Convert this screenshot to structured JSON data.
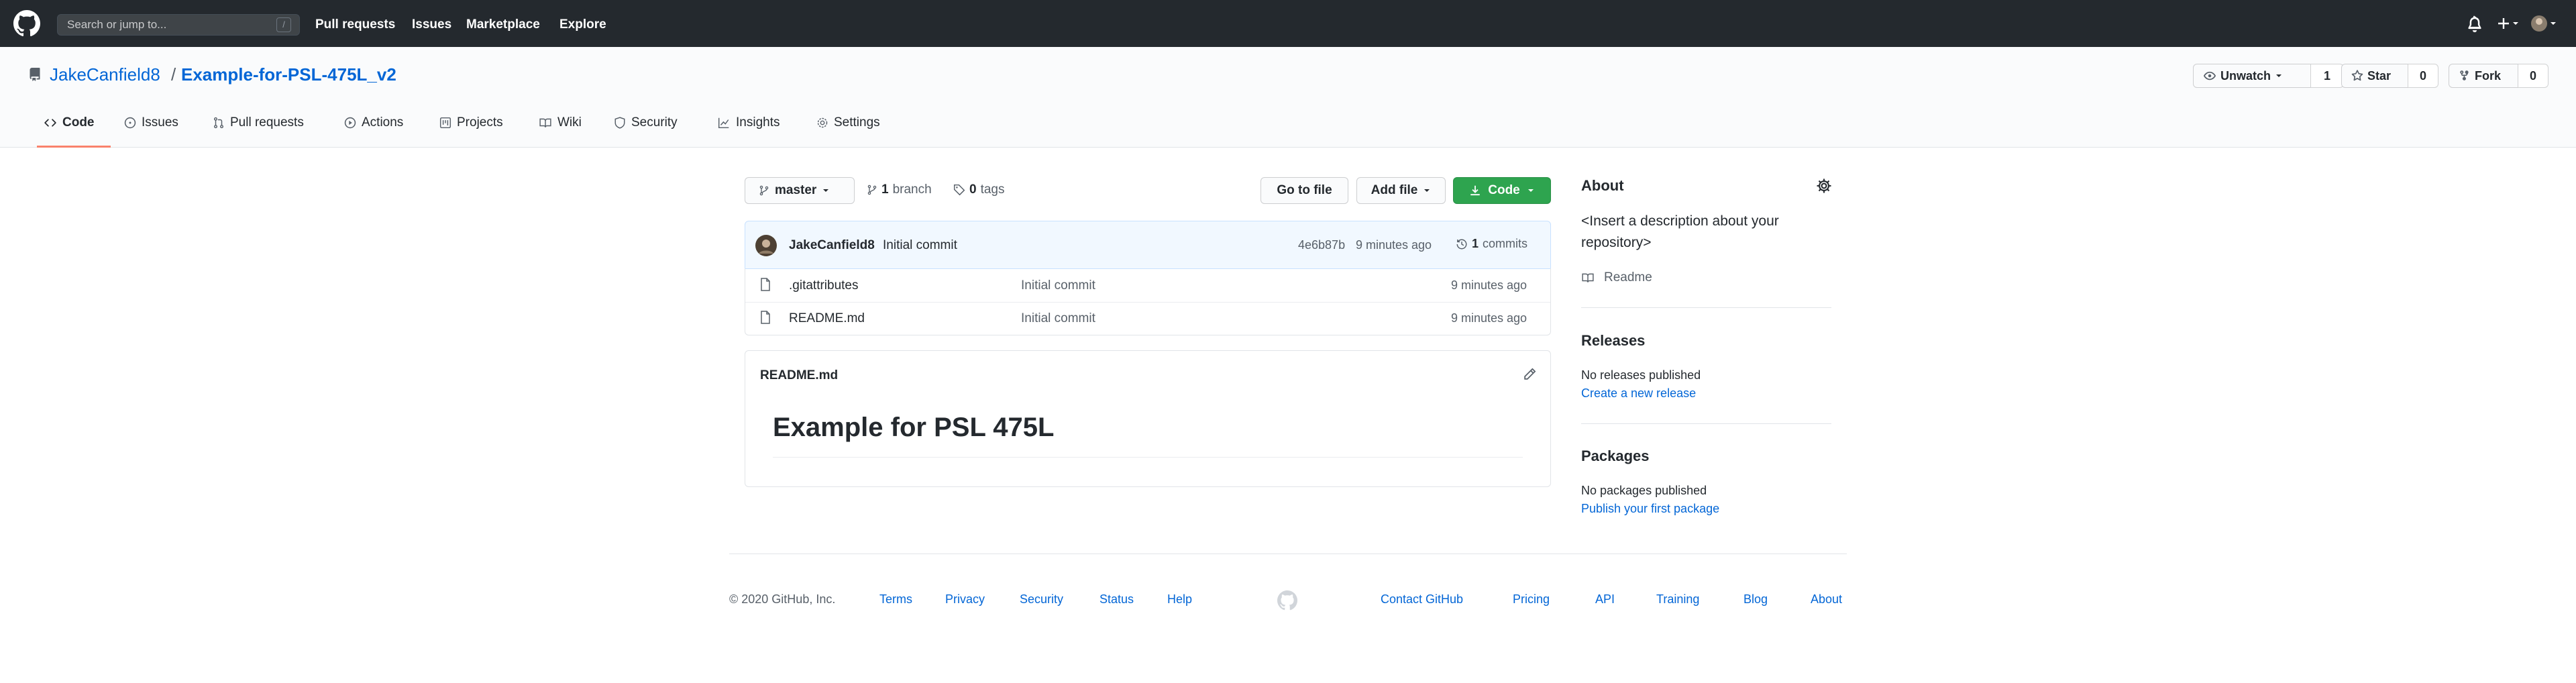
{
  "header": {
    "search_placeholder": "Search or jump to...",
    "search_key": "/",
    "nav": [
      "Pull requests",
      "Issues",
      "Marketplace",
      "Explore"
    ]
  },
  "repo": {
    "owner": "JakeCanfield8",
    "separator": "/",
    "name": "Example-for-PSL-475L_v2",
    "unwatch_label": "Unwatch",
    "watch_count": "1",
    "star_label": "Star",
    "star_count": "0",
    "fork_label": "Fork",
    "fork_count": "0",
    "tabs": [
      "Code",
      "Issues",
      "Pull requests",
      "Actions",
      "Projects",
      "Wiki",
      "Security",
      "Insights",
      "Settings"
    ]
  },
  "browser": {
    "branch": "master",
    "branch_count": "1",
    "branch_word": "branch",
    "tag_count": "0",
    "tag_word": "tags",
    "go_to_file": "Go to file",
    "add_file": "Add file",
    "code": "Code",
    "commit": {
      "author": "JakeCanfield8",
      "message": "Initial commit",
      "sha": "4e6b87b",
      "time": "9 minutes ago",
      "count": "1",
      "count_word": "commits"
    },
    "files": [
      {
        "name": ".gitattributes",
        "message": "Initial commit",
        "time": "9 minutes ago"
      },
      {
        "name": "README.md",
        "message": "Initial commit",
        "time": "9 minutes ago"
      }
    ]
  },
  "readme": {
    "filename": "README.md",
    "heading": "Example for PSL 475L"
  },
  "about": {
    "title": "About",
    "description": "<Insert a description about your repository>",
    "readme_link": "Readme"
  },
  "releases": {
    "title": "Releases",
    "status": "No releases published",
    "link": "Create a new release"
  },
  "packages": {
    "title": "Packages",
    "status": "No packages published",
    "link": "Publish your first package"
  },
  "footer": {
    "copyright": "© 2020 GitHub, Inc.",
    "left_links": [
      "Terms",
      "Privacy",
      "Security",
      "Status",
      "Help"
    ],
    "right_links": [
      "Contact GitHub",
      "Pricing",
      "API",
      "Training",
      "Blog",
      "About"
    ]
  },
  "colors": {
    "header_bg": "#24292e",
    "link": "#0366d6",
    "primary_green": "#2ea44f",
    "tab_accent": "#f9826c"
  }
}
